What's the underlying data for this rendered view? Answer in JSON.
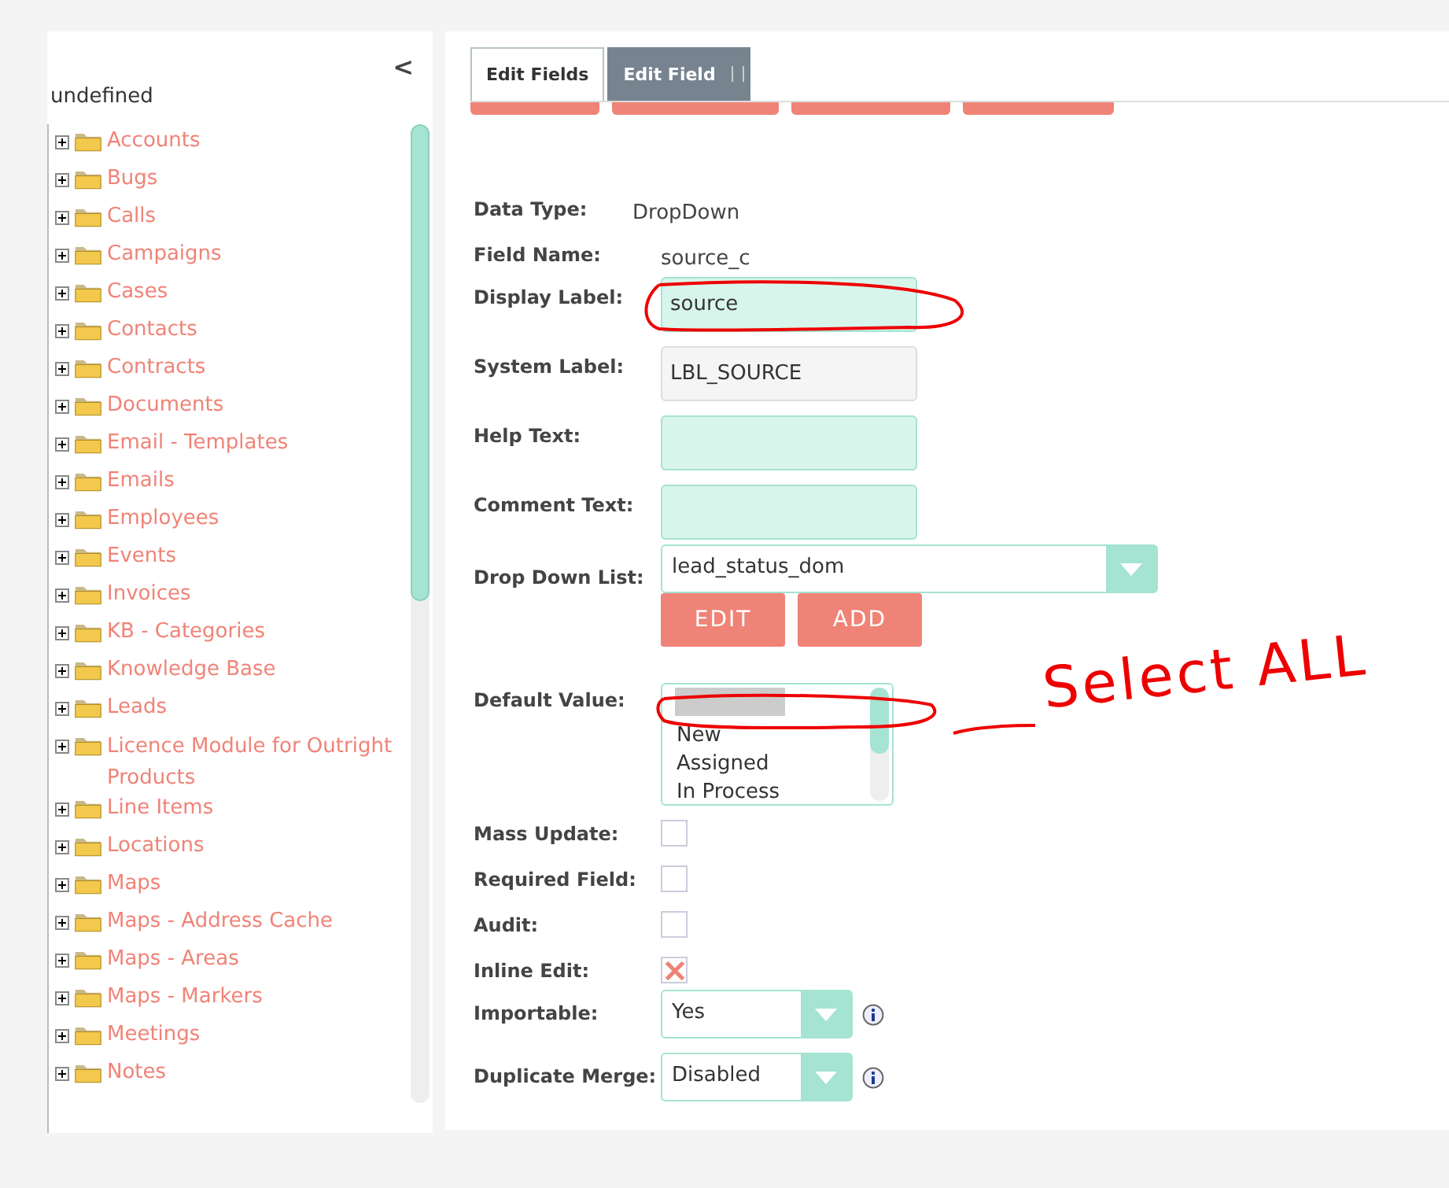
{
  "sidebar": {
    "collapse_glyph": "<",
    "title": "undefined",
    "items": [
      {
        "label": "Accounts",
        "expanded": false
      },
      {
        "label": "Bugs",
        "expanded": false
      },
      {
        "label": "Calls",
        "expanded": false
      },
      {
        "label": "Campaigns",
        "expanded": false
      },
      {
        "label": "Cases",
        "expanded": false
      },
      {
        "label": "Contacts",
        "expanded": false
      },
      {
        "label": "Contracts",
        "expanded": false
      },
      {
        "label": "Documents",
        "expanded": false
      },
      {
        "label": "Email - Templates",
        "expanded": false
      },
      {
        "label": "Emails",
        "expanded": false
      },
      {
        "label": "Employees",
        "expanded": false
      },
      {
        "label": "Events",
        "expanded": false
      },
      {
        "label": "Invoices",
        "expanded": false
      },
      {
        "label": "KB - Categories",
        "expanded": false
      },
      {
        "label": "Knowledge Base",
        "expanded": false
      },
      {
        "label": "Leads",
        "expanded": false
      },
      {
        "label": "Licence Module for Outright Products",
        "expanded": false
      },
      {
        "label": "Line Items",
        "expanded": false
      },
      {
        "label": "Locations",
        "expanded": false
      },
      {
        "label": "Maps",
        "expanded": false
      },
      {
        "label": "Maps - Address Cache",
        "expanded": false
      },
      {
        "label": "Maps - Areas",
        "expanded": false
      },
      {
        "label": "Maps - Markers",
        "expanded": false
      },
      {
        "label": "Meetings",
        "expanded": false
      },
      {
        "label": "Notes",
        "expanded": false
      }
    ]
  },
  "tabs": [
    {
      "label": "Edit Fields",
      "selected": false
    },
    {
      "label": "Edit Field",
      "selected": true
    }
  ],
  "form": {
    "rows": [
      {
        "kind": "text",
        "label": "Data Type:",
        "value": "DropDown"
      },
      {
        "kind": "text",
        "label": "Field Name:",
        "value": "source_c"
      },
      {
        "kind": "input",
        "label": "Display Label:",
        "value": "source",
        "disabled": false
      },
      {
        "kind": "input",
        "label": "System Label:",
        "value": "LBL_SOURCE",
        "disabled": true
      },
      {
        "kind": "input",
        "label": "Help Text:",
        "disabled": false
      },
      {
        "kind": "input",
        "label": "Comment Text:",
        "disabled": false
      },
      {
        "kind": "dropdown_list",
        "label": "Drop Down List:",
        "value": "lead_status_dom",
        "buttons": [
          "EDIT",
          "ADD"
        ]
      },
      {
        "kind": "listbox",
        "label": "Default Value:",
        "blank_option_selected": true,
        "options": [
          {
            "label": "New",
            "selected": false
          },
          {
            "label": "Assigned",
            "selected": false
          },
          {
            "label": "In Process",
            "selected": false
          }
        ]
      },
      {
        "kind": "checkbox",
        "label": "Mass Update:",
        "checked": false
      },
      {
        "kind": "checkbox",
        "label": "Required Field:",
        "checked": false
      },
      {
        "kind": "checkbox",
        "label": "Audit:",
        "checked": false
      },
      {
        "kind": "checkbox",
        "label": "Inline Edit:",
        "checked": true
      },
      {
        "kind": "select",
        "label": "Importable:",
        "value": "Yes"
      },
      {
        "kind": "select",
        "label": "Duplicate Merge:",
        "value": "Disabled"
      }
    ]
  },
  "annotation": {
    "text": "Select ALL"
  }
}
